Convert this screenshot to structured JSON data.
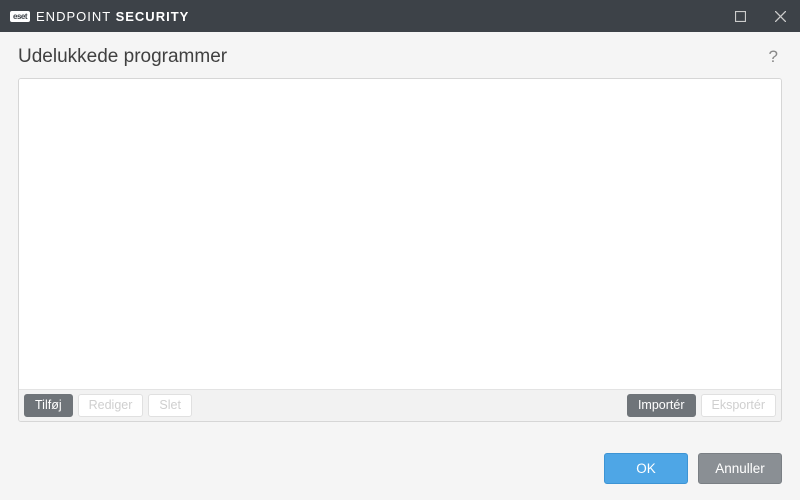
{
  "titlebar": {
    "logo_badge": "eset",
    "product_name_light": "ENDPOINT ",
    "product_name_bold": "SECURITY"
  },
  "page": {
    "title": "Udelukkede programmer",
    "help_symbol": "?"
  },
  "toolbar": {
    "add_label": "Tilføj",
    "edit_label": "Rediger",
    "delete_label": "Slet",
    "import_label": "Importér",
    "export_label": "Eksportér"
  },
  "footer": {
    "ok_label": "OK",
    "cancel_label": "Annuller"
  }
}
